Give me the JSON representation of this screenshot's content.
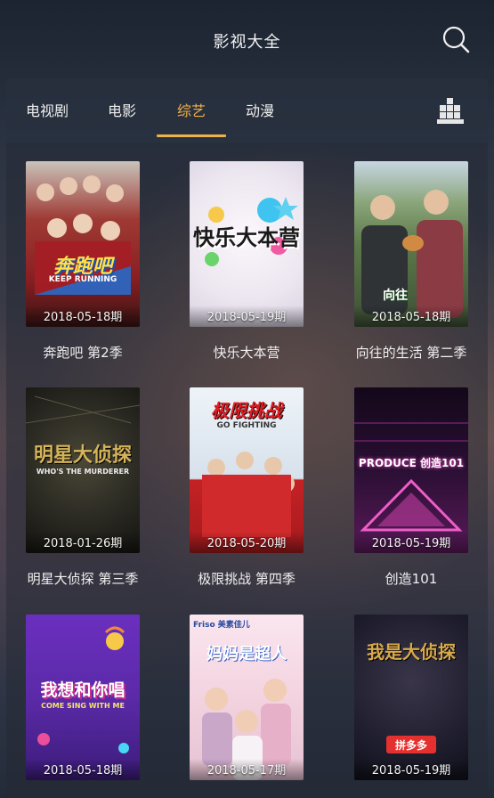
{
  "header": {
    "title": "影视大全",
    "search_icon": "search-icon"
  },
  "tabs": [
    {
      "label": "电视剧",
      "active": false
    },
    {
      "label": "电影",
      "active": false
    },
    {
      "label": "综艺",
      "active": true
    },
    {
      "label": "动漫",
      "active": false
    }
  ],
  "accent_color": "#f0b14b",
  "grid_icon": "grid-icon",
  "shows": [
    {
      "title": "奔跑吧 第2季",
      "date": "2018-05-18期",
      "logo": "奔跑吧",
      "logo_sub": "KEEP RUNNING",
      "palette": [
        "#9a2a2a",
        "#c7b8a8"
      ]
    },
    {
      "title": "快乐大本营",
      "date": "2018-05-19期",
      "logo": "快乐大本营",
      "logo_sub": "",
      "palette": [
        "#e9e4ee",
        "#f26aa5"
      ]
    },
    {
      "title": "向往的生活 第二季",
      "date": "2018-05-18期",
      "logo": "向往",
      "logo_sub": "",
      "palette": [
        "#6e8f55",
        "#3b4a3a"
      ]
    },
    {
      "title": "明星大侦探 第三季",
      "date": "2018-01-26期",
      "logo": "明星大侦探",
      "logo_sub": "WHO'S THE MURDERER",
      "palette": [
        "#2c2a22",
        "#b89a3c"
      ]
    },
    {
      "title": "极限挑战 第四季",
      "date": "2018-05-20期",
      "logo": "极限挑战",
      "logo_sub": "GO FIGHTING",
      "palette": [
        "#cfd9e6",
        "#d0282a"
      ]
    },
    {
      "title": "创造101",
      "date": "2018-05-19期",
      "logo": "PRODUCE 创造101",
      "logo_sub": "",
      "palette": [
        "#1a0b1f",
        "#e54ab8"
      ]
    },
    {
      "title": "",
      "date": "2018-05-18期",
      "logo": "我想和你唱",
      "logo_sub": "COME SING WITH ME",
      "palette": [
        "#5b2aa8",
        "#9a5ee3"
      ]
    },
    {
      "title": "",
      "date": "2018-05-17期",
      "logo": "妈妈是超人",
      "logo_sub": "Friso 美素佳儿",
      "palette": [
        "#f3d3e0",
        "#e9a4c4"
      ]
    },
    {
      "title": "",
      "date": "2018-05-19期",
      "logo": "我是大侦探",
      "logo_sub": "拼多多",
      "palette": [
        "#1c1b2a",
        "#d7a94a"
      ]
    }
  ]
}
